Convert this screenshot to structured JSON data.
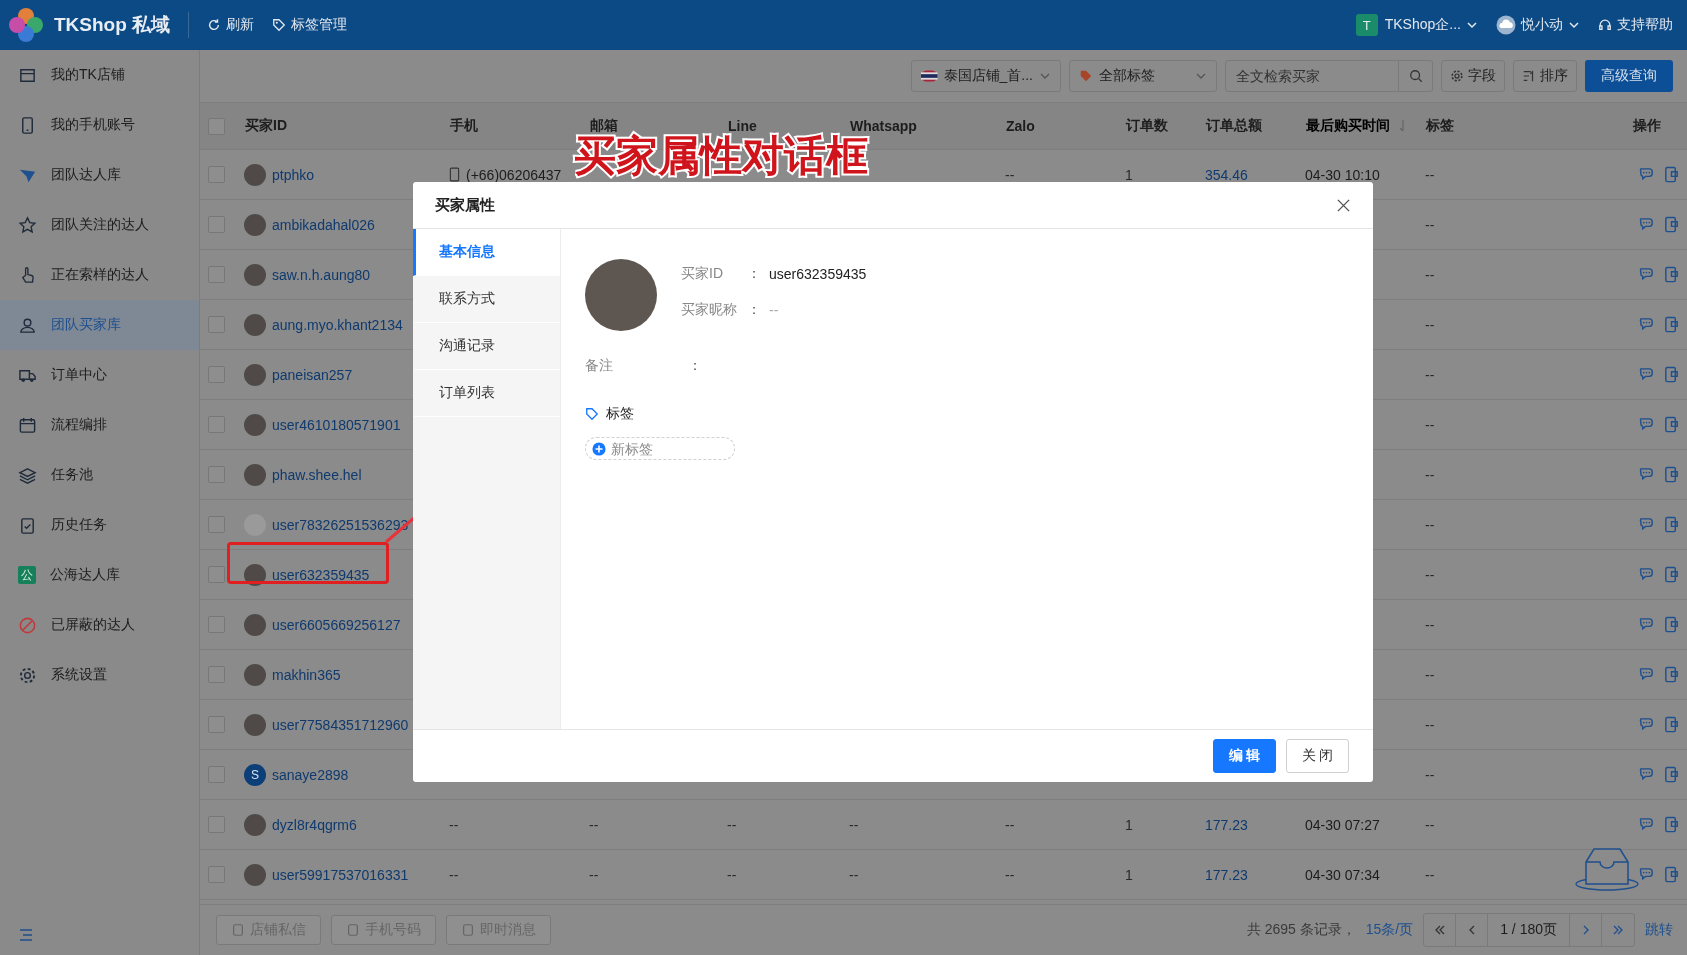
{
  "topbar": {
    "brand": "TKShop 私域",
    "actions": [
      {
        "label": "刷新"
      },
      {
        "label": "标签管理"
      }
    ],
    "team": {
      "badge": "T",
      "name": "TKShop企..."
    },
    "user": {
      "name": "悦小动"
    },
    "help": {
      "label": "支持帮助"
    }
  },
  "sidebar": {
    "items": [
      {
        "label": "我的TK店铺",
        "selected": false
      },
      {
        "label": "我的手机账号",
        "selected": false
      },
      {
        "label": "团队达人库",
        "selected": false
      },
      {
        "label": "团队关注的达人",
        "selected": false
      },
      {
        "label": "正在索样的达人",
        "selected": false
      },
      {
        "label": "团队买家库",
        "selected": true
      },
      {
        "label": "订单中心",
        "selected": false
      },
      {
        "label": "流程编排",
        "selected": false
      },
      {
        "label": "任务池",
        "selected": false
      },
      {
        "label": "历史任务",
        "selected": false
      },
      {
        "label": "公海达人库",
        "selected": false,
        "badge": "公"
      },
      {
        "label": "已屏蔽的达人",
        "selected": false
      },
      {
        "label": "系统设置",
        "selected": false
      }
    ]
  },
  "toolbar": {
    "shop_select": "泰国店铺_首...",
    "tag_select": "全部标签",
    "search": {
      "placeholder": "全文检索买家"
    },
    "buttons": [
      {
        "label": "字段"
      },
      {
        "label": "排序"
      }
    ],
    "primary": "高级查询"
  },
  "table": {
    "select_all": {
      "checked": false
    },
    "columns": [
      {
        "label": "买家ID",
        "sorted": false
      },
      {
        "label": "手机",
        "sorted": false
      },
      {
        "label": "邮箱",
        "sorted": false
      },
      {
        "label": "Line",
        "sorted": false
      },
      {
        "label": "Whatsapp",
        "sorted": false
      },
      {
        "label": "Zalo",
        "sorted": false
      },
      {
        "label": "订单数",
        "sorted": false
      },
      {
        "label": "订单总额",
        "sorted": false
      },
      {
        "label": "最后购买时间",
        "sorted": true
      },
      {
        "label": "标签",
        "sorted": false
      },
      {
        "label": "操作",
        "sorted": false
      }
    ],
    "rows": [
      {
        "checked": false,
        "avatar": {
          "kind": "photo"
        },
        "id": "ptphko",
        "device_icon": true,
        "phone": "(+66)06206437",
        "zalo": "--",
        "orders": "1",
        "total": "354.46",
        "last": "04-30 10:10",
        "tag": "--"
      },
      {
        "checked": false,
        "avatar": {
          "kind": "photo"
        },
        "id": "ambikadahal026",
        "tag": "--"
      },
      {
        "checked": false,
        "avatar": {
          "kind": "photo"
        },
        "id": "saw.n.h.aung80",
        "tag": "--"
      },
      {
        "checked": false,
        "avatar": {
          "kind": "photo"
        },
        "id": "aung.myo.khant2134",
        "tag": "--"
      },
      {
        "checked": false,
        "avatar": {
          "kind": "photo"
        },
        "id": "paneisan257",
        "tag": "--"
      },
      {
        "checked": false,
        "avatar": {
          "kind": "photo"
        },
        "id": "user4610180571901",
        "tag": "--"
      },
      {
        "checked": false,
        "avatar": {
          "kind": "photo"
        },
        "id": "phaw.shee.hel",
        "tag": "--"
      },
      {
        "checked": false,
        "avatar": {
          "kind": "default"
        },
        "id": "user78326251536293",
        "tag": "--"
      },
      {
        "checked": false,
        "avatar": {
          "kind": "photo"
        },
        "id": "user632359435",
        "tag": "--"
      },
      {
        "checked": false,
        "avatar": {
          "kind": "photo"
        },
        "id": "user6605669256127",
        "tag": "--"
      },
      {
        "checked": false,
        "avatar": {
          "kind": "photo"
        },
        "id": "makhin365",
        "tag": "--"
      },
      {
        "checked": false,
        "avatar": {
          "kind": "photo"
        },
        "id": "user77584351712960",
        "tag": "--"
      },
      {
        "checked": false,
        "avatar": {
          "kind": "letter",
          "letter": "S"
        },
        "id": "sanaye2898",
        "tag": "--"
      },
      {
        "checked": false,
        "avatar": {
          "kind": "photo"
        },
        "id": "dyzl8r4qgrm6",
        "phone": "--",
        "email": "--",
        "line": "--",
        "whatsapp": "--",
        "zalo": "--",
        "orders": "1",
        "total": "177.23",
        "last": "04-30 07:27",
        "tag": "--"
      },
      {
        "checked": false,
        "avatar": {
          "kind": "photo"
        },
        "id": "user59917537016331",
        "phone": "--",
        "email": "--",
        "line": "--",
        "whatsapp": "--",
        "zalo": "--",
        "orders": "1",
        "total": "177.23",
        "last": "04-30 07:34",
        "tag": "--"
      }
    ]
  },
  "footer": {
    "buttons": [
      {
        "label": "店铺私信",
        "disabled": true
      },
      {
        "label": "手机号码",
        "disabled": true
      },
      {
        "label": "即时消息",
        "disabled": true
      }
    ],
    "total": "共 2695 条记录，",
    "page_size": "15条/页",
    "page": "1 / 180页",
    "jump": "跳转"
  },
  "dialog": {
    "title": "买家属性",
    "tabs": [
      {
        "label": "基本信息",
        "selected": true
      },
      {
        "label": "联系方式",
        "selected": false
      },
      {
        "label": "沟通记录",
        "selected": false
      },
      {
        "label": "订单列表",
        "selected": false
      }
    ],
    "fields": [
      {
        "label": "买家ID",
        "colon": "：",
        "value": "user632359435"
      },
      {
        "label": "买家昵称",
        "colon": "：",
        "value": "--"
      }
    ],
    "note": {
      "label": "备注",
      "colon": "："
    },
    "tags": {
      "label": "标签",
      "placeholder": "新标签"
    },
    "buttons": [
      {
        "label": "编 辑",
        "kind": "primary"
      },
      {
        "label": "关 闭",
        "kind": "default"
      }
    ]
  },
  "annotation": {
    "text": "买家属性对话框"
  }
}
